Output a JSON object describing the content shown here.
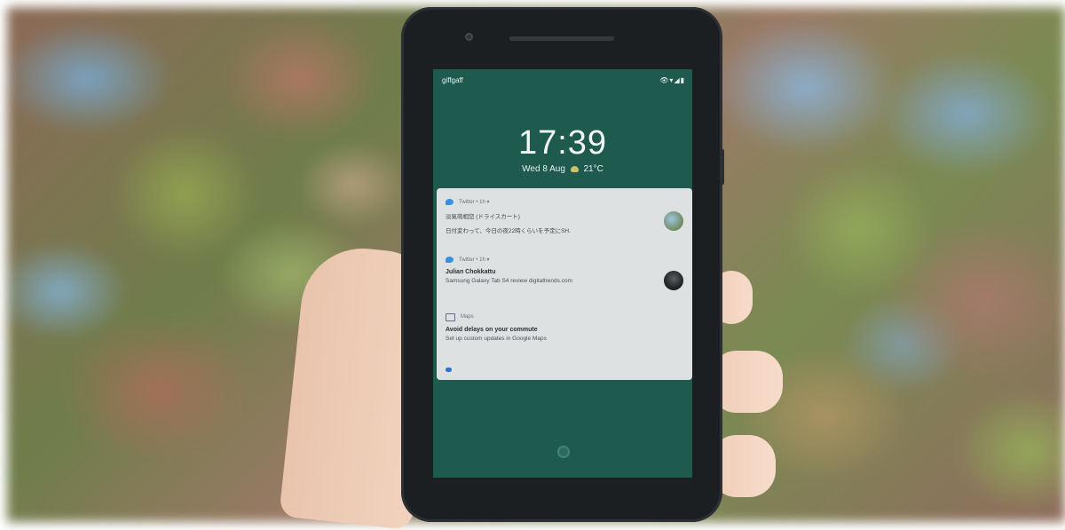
{
  "lock_screen": {
    "carrier": "giffgaff",
    "status_icons": "👁▾◢▮",
    "time": "17:39",
    "date": "Wed 8 Aug",
    "temperature": "21°C"
  },
  "notifications": [
    {
      "app": "Twitter • 1h ▾",
      "icon": "twitter-bird-icon",
      "lines": [
        "淡氣萌相您 (ドライスカート)",
        "日付変わって、今日の夜22時くらいを予定にSH."
      ]
    },
    {
      "app": "Twitter • 1h ▾",
      "icon": "twitter-bird-icon",
      "title": "Julian Chokkattu",
      "text": "Samsung Galaxy Tab S4 review digitaltrends.com"
    },
    {
      "app": "Maps",
      "icon": "maps-icon",
      "title": "Avoid delays on your commute",
      "text": "Set up custom updates in Google Maps"
    }
  ]
}
